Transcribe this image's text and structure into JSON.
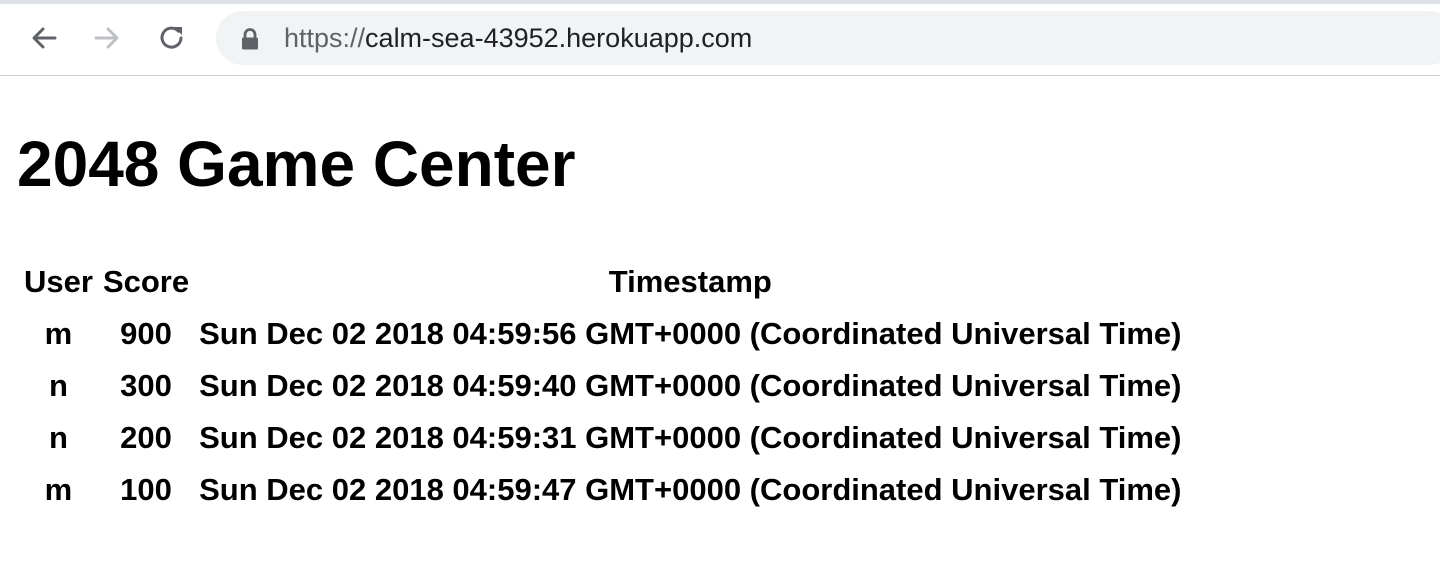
{
  "browser": {
    "url_scheme": "https://",
    "url_host": "calm-sea-43952.herokuapp.com",
    "back_icon": "back-arrow-icon",
    "forward_icon": "forward-arrow-icon",
    "reload_icon": "reload-icon",
    "lock_icon": "lock-icon"
  },
  "page": {
    "title": "2048 Game Center"
  },
  "table": {
    "headers": [
      "User",
      "Score",
      "Timestamp"
    ],
    "rows": [
      {
        "user": "m",
        "score": "900",
        "timestamp": "Sun Dec 02 2018 04:59:56 GMT+0000 (Coordinated Universal Time)"
      },
      {
        "user": "n",
        "score": "300",
        "timestamp": "Sun Dec 02 2018 04:59:40 GMT+0000 (Coordinated Universal Time)"
      },
      {
        "user": "n",
        "score": "200",
        "timestamp": "Sun Dec 02 2018 04:59:31 GMT+0000 (Coordinated Universal Time)"
      },
      {
        "user": "m",
        "score": "100",
        "timestamp": "Sun Dec 02 2018 04:59:47 GMT+0000 (Coordinated Universal Time)"
      }
    ]
  },
  "colors": {
    "toolbar_bg": "#ffffff",
    "omnibox_bg": "#f1f3f4",
    "icon_active": "#5f6368",
    "icon_disabled": "#bdc1c6",
    "text": "#000000"
  }
}
